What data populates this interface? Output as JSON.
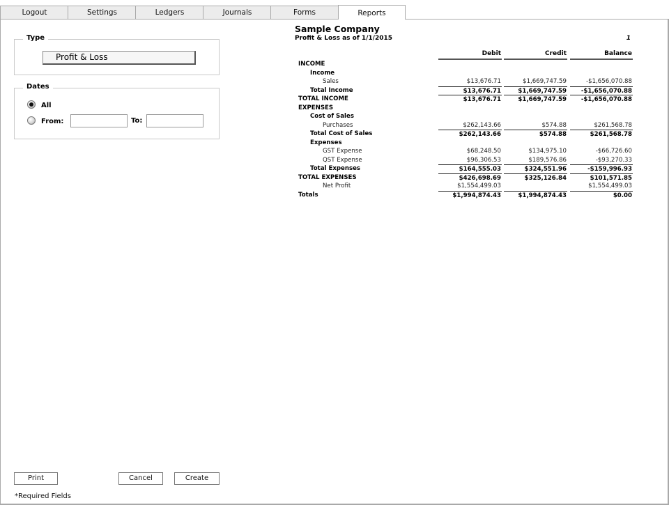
{
  "tabs": [
    {
      "label": "Logout",
      "active": false
    },
    {
      "label": "Settings",
      "active": false
    },
    {
      "label": "Ledgers",
      "active": false
    },
    {
      "label": "Journals",
      "active": false
    },
    {
      "label": "Forms",
      "active": false
    },
    {
      "label": "Reports",
      "active": true
    }
  ],
  "type_section": {
    "legend": "Type",
    "selected": "Profit & Loss"
  },
  "dates_section": {
    "legend": "Dates",
    "all_label": "All",
    "all_checked": true,
    "from_label": "From:",
    "from_checked": false,
    "from_value": "",
    "to_label": "To:",
    "to_value": ""
  },
  "buttons": {
    "print": "Print",
    "cancel": "Cancel",
    "create": "Create"
  },
  "required_note": "*Required Fields",
  "report": {
    "company": "Sample Company",
    "subtitle": "Profit & Loss as of 1/1/2015",
    "page": "1",
    "columns": {
      "debit": "Debit",
      "credit": "Credit",
      "balance": "Balance"
    },
    "rows": [
      {
        "label": "INCOME",
        "indent": 0,
        "bold": true,
        "line": false,
        "debit": "",
        "credit": "",
        "balance": ""
      },
      {
        "label": "Income",
        "indent": 1,
        "bold": true,
        "line": false,
        "debit": "",
        "credit": "",
        "balance": ""
      },
      {
        "label": "Sales",
        "indent": 2,
        "bold": false,
        "line": false,
        "debit": "$13,676.71",
        "credit": "$1,669,747.59",
        "balance": "-$1,656,070.88"
      },
      {
        "label": "Total Income",
        "indent": 1,
        "bold": true,
        "line": true,
        "debit": "$13,676.71",
        "credit": "$1,669,747.59",
        "balance": "-$1,656,070.88"
      },
      {
        "label": "TOTAL INCOME",
        "indent": 0,
        "bold": true,
        "line": true,
        "debit": "$13,676.71",
        "credit": "$1,669,747.59",
        "balance": "-$1,656,070.88"
      },
      {
        "label": "EXPENSES",
        "indent": 0,
        "bold": true,
        "line": false,
        "debit": "",
        "credit": "",
        "balance": ""
      },
      {
        "label": "Cost of Sales",
        "indent": 1,
        "bold": true,
        "line": false,
        "debit": "",
        "credit": "",
        "balance": ""
      },
      {
        "label": "Purchases",
        "indent": 2,
        "bold": false,
        "line": false,
        "debit": "$262,143.66",
        "credit": "$574.88",
        "balance": "$261,568.78"
      },
      {
        "label": "Total Cost of Sales",
        "indent": 1,
        "bold": true,
        "line": true,
        "debit": "$262,143.66",
        "credit": "$574.88",
        "balance": "$261,568.78"
      },
      {
        "label": "Expenses",
        "indent": 1,
        "bold": true,
        "line": false,
        "debit": "",
        "credit": "",
        "balance": ""
      },
      {
        "label": "GST Expense",
        "indent": 2,
        "bold": false,
        "line": false,
        "debit": "$68,248.50",
        "credit": "$134,975.10",
        "balance": "-$66,726.60"
      },
      {
        "label": "QST Expense",
        "indent": 2,
        "bold": false,
        "line": false,
        "debit": "$96,306.53",
        "credit": "$189,576.86",
        "balance": "-$93,270.33"
      },
      {
        "label": "Total Expenses",
        "indent": 1,
        "bold": true,
        "line": true,
        "debit": "$164,555.03",
        "credit": "$324,551.96",
        "balance": "-$159,996.93"
      },
      {
        "label": "TOTAL EXPENSES",
        "indent": 0,
        "bold": true,
        "line": true,
        "debit": "$426,698.69",
        "credit": "$325,126.84",
        "balance": "$101,571.85"
      },
      {
        "label": "Net Profit",
        "indent": 2,
        "bold": false,
        "line": false,
        "debit": "$1,554,499.03",
        "credit": "",
        "balance": "$1,554,499.03"
      },
      {
        "label": "Totals",
        "indent": 0,
        "bold": true,
        "line": true,
        "debit": "$1,994,874.43",
        "credit": "$1,994,874.43",
        "balance": "$0.00"
      }
    ]
  }
}
